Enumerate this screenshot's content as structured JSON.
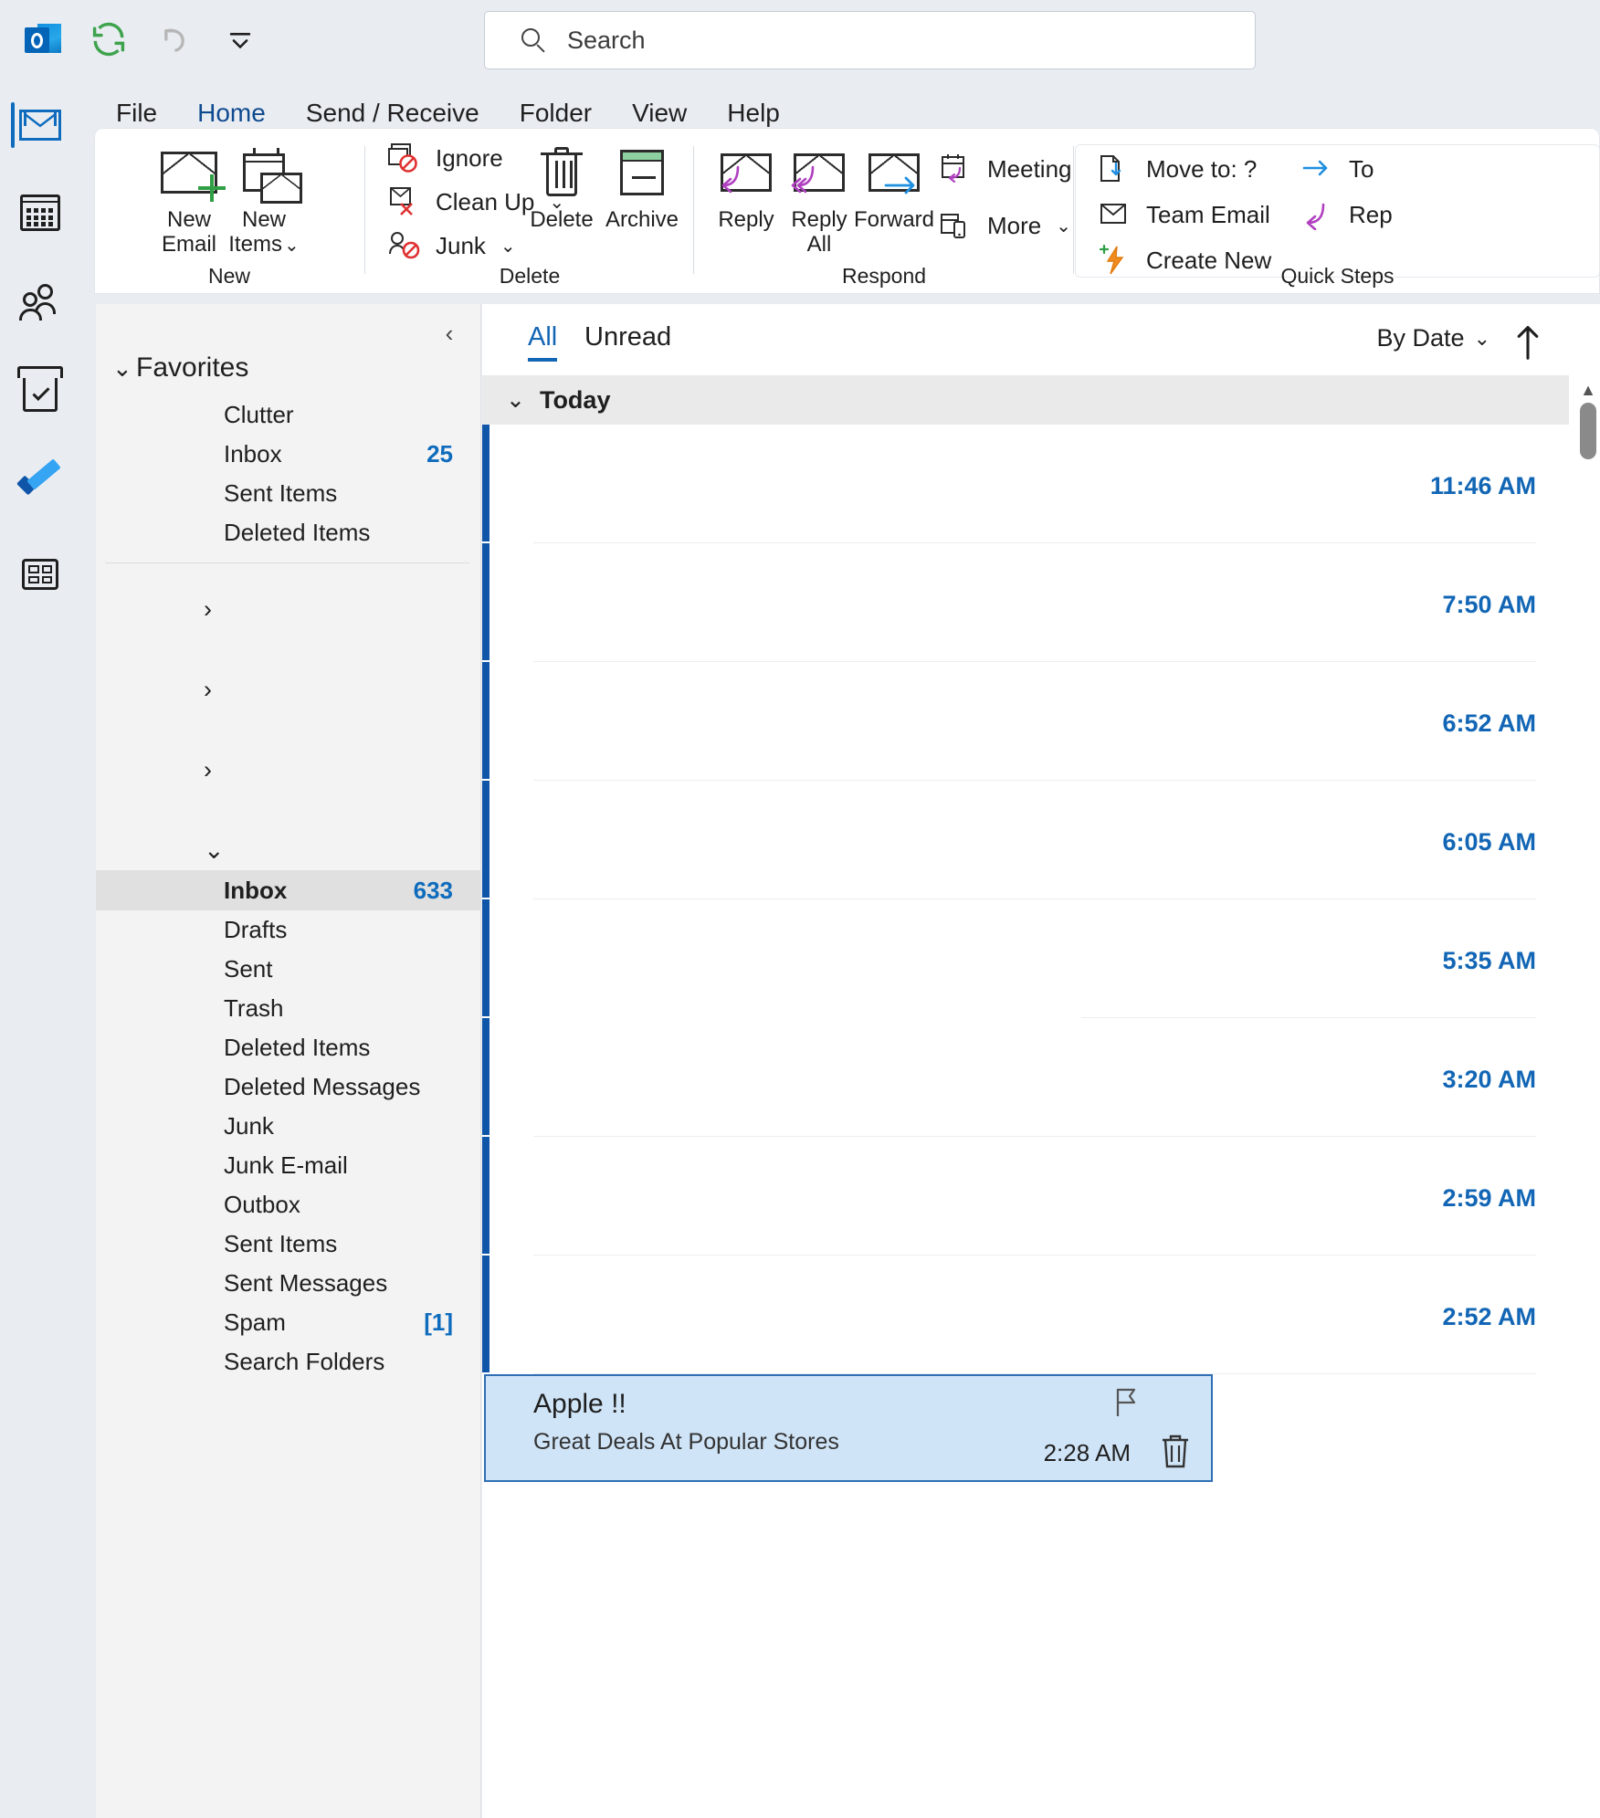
{
  "quick_access": {
    "items": [
      {
        "name": "outlook-logo",
        "label": "Outlook"
      },
      {
        "name": "send-receive-all-icon",
        "label": "Send/Receive All Folders"
      },
      {
        "name": "undo-icon",
        "label": "Undo"
      },
      {
        "name": "customize-quick-access-toolbar-icon",
        "label": "Customize Quick Access Toolbar"
      }
    ]
  },
  "search": {
    "placeholder": "Search",
    "value": "",
    "icon": "search-icon"
  },
  "rail": {
    "items": [
      {
        "name": "mail-icon",
        "label": "Mail",
        "active": true
      },
      {
        "name": "calendar-icon",
        "label": "Calendar",
        "active": false
      },
      {
        "name": "people-icon",
        "label": "People",
        "active": false
      },
      {
        "name": "tasks-icon",
        "label": "Tasks",
        "active": false
      },
      {
        "name": "todo-icon",
        "label": "To Do",
        "active": false
      },
      {
        "name": "more-apps-icon",
        "label": "More apps",
        "active": false
      }
    ]
  },
  "ribbon": {
    "tabs": [
      {
        "label": "File",
        "active": false
      },
      {
        "label": "Home",
        "active": true
      },
      {
        "label": "Send / Receive",
        "active": false
      },
      {
        "label": "Folder",
        "active": false
      },
      {
        "label": "View",
        "active": false
      },
      {
        "label": "Help",
        "active": false
      }
    ],
    "groups": {
      "new": {
        "label": "New",
        "new_email": "New\nEmail",
        "new_email_l1": "New",
        "new_email_l2": "Email",
        "new_items_l1": "New",
        "new_items_l2": "Items"
      },
      "delete": {
        "label": "Delete",
        "ignore": "Ignore",
        "clean_up": "Clean Up",
        "junk": "Junk",
        "delete": "Delete",
        "archive": "Archive"
      },
      "respond": {
        "label": "Respond",
        "reply": "Reply",
        "reply_all_l1": "Reply",
        "reply_all_l2": "All",
        "forward": "Forward",
        "meeting": "Meeting",
        "more": "More"
      },
      "quick_steps": {
        "label": "Quick Steps",
        "move_to": "Move to: ?",
        "team_email": "Team Email",
        "create_new": "Create New",
        "to_manager": "To ",
        "reply_delete": "Rep"
      }
    }
  },
  "folder_pane": {
    "collapse_icon": "chevron-left-icon",
    "favorites": {
      "label": "Favorites",
      "expanded": true,
      "items": [
        {
          "name": "Clutter",
          "count": ""
        },
        {
          "name": "Inbox",
          "count": "25"
        },
        {
          "name": "Sent Items",
          "count": ""
        },
        {
          "name": "Deleted Items",
          "count": ""
        }
      ]
    },
    "collapsed_accounts": [
      {
        "label": "",
        "expanded": false
      },
      {
        "label": "",
        "expanded": false
      },
      {
        "label": "",
        "expanded": false
      }
    ],
    "expanded_account": {
      "label": "",
      "expanded": true,
      "items": [
        {
          "name": "Inbox",
          "count": "633",
          "selected": true
        },
        {
          "name": "Drafts",
          "count": "",
          "selected": false
        },
        {
          "name": "Sent",
          "count": "",
          "selected": false
        },
        {
          "name": "Trash",
          "count": "",
          "selected": false
        },
        {
          "name": "Deleted Items",
          "count": "",
          "selected": false
        },
        {
          "name": "Deleted Messages",
          "count": "",
          "selected": false
        },
        {
          "name": "Junk",
          "count": "",
          "selected": false
        },
        {
          "name": "Junk E-mail",
          "count": "",
          "selected": false
        },
        {
          "name": "Outbox",
          "count": "",
          "selected": false
        },
        {
          "name": "Sent Items",
          "count": "",
          "selected": false
        },
        {
          "name": "Sent Messages",
          "count": "",
          "selected": false
        },
        {
          "name": "Spam",
          "count": "[1]",
          "selected": false
        },
        {
          "name": "Search Folders",
          "count": "",
          "selected": false
        }
      ]
    }
  },
  "message_list": {
    "filters": [
      {
        "label": "All",
        "active": true
      },
      {
        "label": "Unread",
        "active": false
      }
    ],
    "sort": {
      "label": "By Date",
      "chevron": "chevron-down-icon"
    },
    "sort_direction_icon": "arrow-up-icon",
    "group": {
      "label": "Today",
      "expanded": true
    },
    "messages": [
      {
        "sender": "",
        "subject": "",
        "preview": "",
        "time": "11:46 AM",
        "unread": true,
        "selected": false
      },
      {
        "sender": "",
        "subject": "",
        "preview": "",
        "time": "7:50 AM",
        "unread": true,
        "selected": false
      },
      {
        "sender": "",
        "subject": "",
        "preview": "",
        "time": "6:52 AM",
        "unread": true,
        "selected": false
      },
      {
        "sender": "",
        "subject": "",
        "preview": "",
        "time": "6:05 AM",
        "unread": true,
        "selected": false
      },
      {
        "sender": "",
        "subject": "",
        "preview": "",
        "time": "5:35 AM",
        "unread": true,
        "selected": false
      },
      {
        "sender": "",
        "subject": "",
        "preview": "",
        "time": "3:20 AM",
        "unread": true,
        "selected": false
      },
      {
        "sender": "",
        "subject": "",
        "preview": "",
        "time": "2:59 AM",
        "unread": true,
        "selected": false
      },
      {
        "sender": "",
        "subject": "",
        "preview": "",
        "time": "2:52 AM",
        "unread": true,
        "selected": false
      }
    ],
    "selected_message": {
      "subject": "Apple !!",
      "preview": "Great Deals At Popular Stores",
      "time": "2:28 AM",
      "flag_icon": "flag-icon",
      "delete_icon": "trash-icon"
    }
  },
  "colors": {
    "accent_blue": "#1266b5",
    "unread_bar": "#0f55a8",
    "selected_row": "#cfe4f7",
    "ribbon_bg": "#ffffff",
    "chrome_bg": "#e9edf2",
    "folder_pane_bg": "#f3f3f3"
  }
}
